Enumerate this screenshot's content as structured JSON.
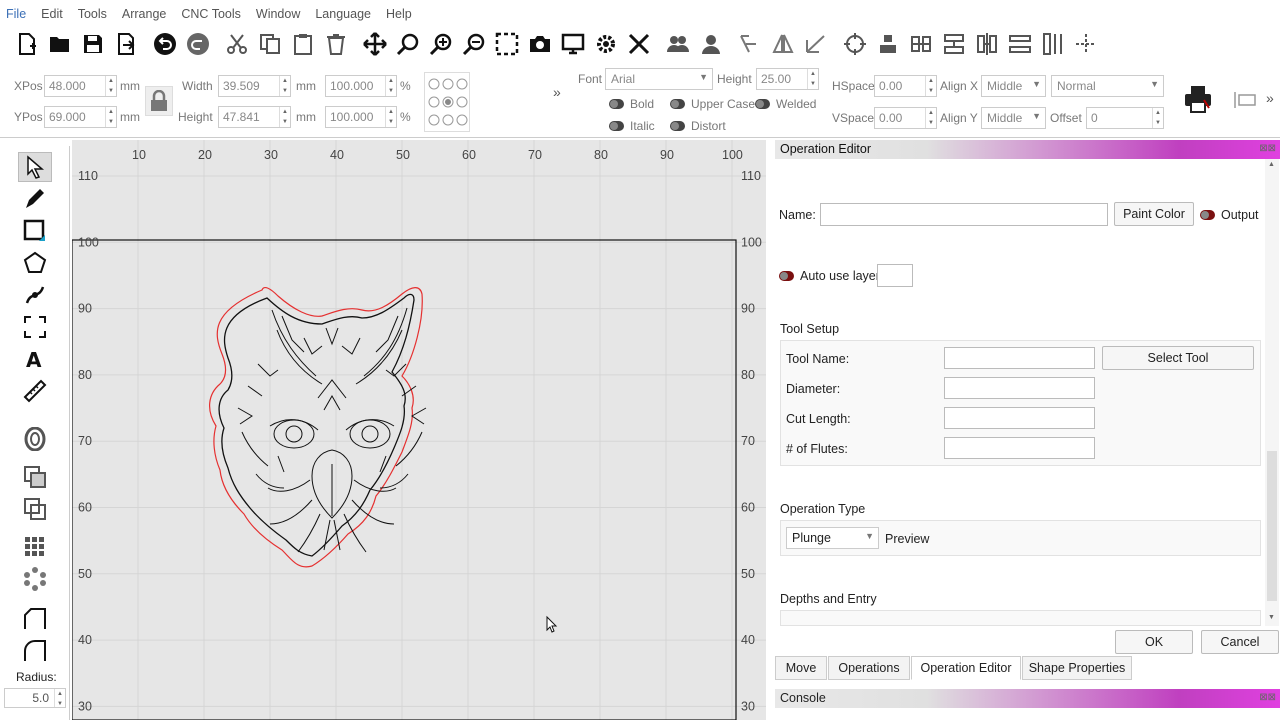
{
  "menu": [
    "File",
    "Edit",
    "Tools",
    "Arrange",
    "CNC Tools",
    "Window",
    "Language",
    "Help"
  ],
  "toolbar_icons": [
    "new-file",
    "open-folder",
    "save",
    "export",
    "undo",
    "redo",
    "cut",
    "copy",
    "paste",
    "delete",
    "move-cross",
    "zoom-fit",
    "zoom-in",
    "zoom-out",
    "select-box",
    "camera",
    "monitor",
    "gear",
    "wrench",
    "group",
    "ungroup",
    "mirror",
    "flip",
    "rotate",
    "target",
    "align-top",
    "align-center",
    "distribute-h",
    "distribute-v",
    "space-h",
    "space-v",
    "crosshair"
  ],
  "props": {
    "xpos_label": "XPos",
    "xpos": "48.000",
    "ypos_label": "YPos",
    "ypos": "69.000",
    "unit": "mm",
    "width_label": "Width",
    "width": "39.509",
    "height_label": "Height",
    "height": "47.841",
    "scale_w": "100.000",
    "scale_h": "100.000",
    "pct": "%",
    "more": "»",
    "font_label": "Font",
    "font": "Arial",
    "fheight_label": "Height",
    "fheight": "25.00",
    "bold": "Bold",
    "italic": "Italic",
    "upper": "Upper Case",
    "welded": "Welded",
    "distort": "Distort",
    "hspace_label": "HSpace",
    "hspace": "0.00",
    "vspace_label": "VSpace",
    "vspace": "0.00",
    "alignx_label": "Align X",
    "alignx": "Middle",
    "aligny_label": "Align Y",
    "aligny": "Middle",
    "mode": "Normal",
    "offset_label": "Offset",
    "offset": "0"
  },
  "left_tools": [
    "select-arrow",
    "pen",
    "rectangle",
    "polygon",
    "node-edit",
    "frame",
    "text",
    "ruler",
    "offset-o",
    "copy-shape",
    "duplicate",
    "grid-array",
    "radial-array",
    "corner",
    "round-corner"
  ],
  "radius": {
    "label": "Radius:",
    "value": "5.0"
  },
  "ruler": {
    "top": [
      "10",
      "20",
      "30",
      "40",
      "50",
      "60",
      "70",
      "80",
      "90",
      "100"
    ],
    "left": [
      "110",
      "100",
      "90",
      "80",
      "70",
      "60",
      "50",
      "40",
      "30"
    ],
    "right": [
      "110",
      "100",
      "90",
      "80",
      "70",
      "60",
      "50",
      "40",
      "30"
    ]
  },
  "panel": {
    "title": "Operation Editor",
    "name_label": "Name:",
    "name_value": "",
    "paint_color": "Paint Color",
    "output": "Output",
    "auto_layer": "Auto use layer",
    "tool_setup": "Tool Setup",
    "tool_name": "Tool Name:",
    "select_tool": "Select Tool",
    "diameter": "Diameter:",
    "cut_length": "Cut Length:",
    "flutes": "# of Flutes:",
    "op_type": "Operation Type",
    "op_value": "Plunge",
    "preview": "Preview",
    "depths": "Depths and Entry",
    "ok": "OK",
    "cancel": "Cancel",
    "tabs": [
      "Move",
      "Operations",
      "Operation Editor",
      "Shape Properties"
    ],
    "console": "Console"
  },
  "colors": {
    "accent_gradient_end": "#e040e0",
    "cut_outline": "#e53030",
    "canvas_bg": "#e6e6e6"
  }
}
